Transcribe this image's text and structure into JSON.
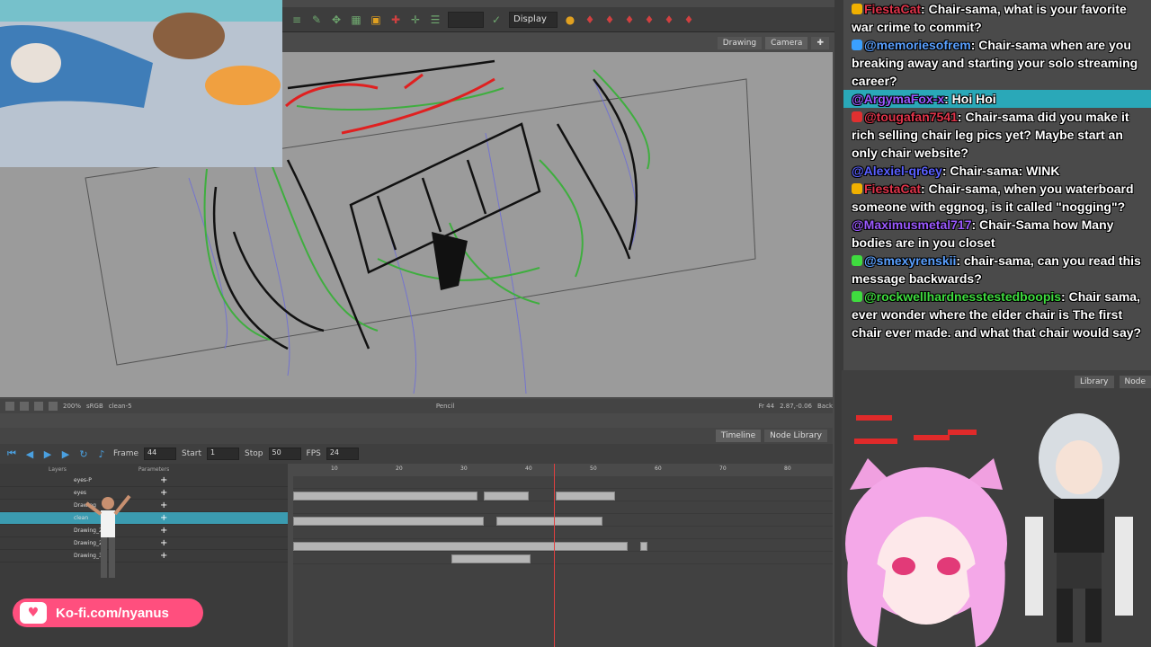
{
  "toolbar": {
    "display_select": "Display"
  },
  "view_tabs": [
    "Drawing",
    "Camera"
  ],
  "canvas_status": {
    "zoom": "200%",
    "color_mode": "sRGB",
    "layer": "clean-5",
    "tool": "Pencil",
    "frame": "Fr 44",
    "coords": "2.87,-0.06",
    "bg": "Back"
  },
  "timeline_tabs": [
    "Timeline",
    "Node Library"
  ],
  "timeline": {
    "frame_label": "Frame",
    "frame_value": "44",
    "start_label": "Start",
    "start_value": "1",
    "stop_label": "Stop",
    "stop_value": "50",
    "fps_label": "FPS",
    "fps_value": "24"
  },
  "layers": {
    "header_layers": "Layers",
    "header_params": "Parameters",
    "rows": [
      "eyes-P",
      "eyes",
      "Drawing",
      "clean",
      "Drawing_2",
      "Drawing_2",
      "Drawing_3"
    ]
  },
  "ruler_ticks": [
    "10",
    "20",
    "30",
    "40",
    "50",
    "60",
    "70",
    "80"
  ],
  "kofi": {
    "text": "Ko-fi.com/nyanus"
  },
  "chat": [
    {
      "user": "FiestaCat",
      "user_color": "#e0344a",
      "text": ": Chair-sama, what is your favorite war crime to commit?"
    },
    {
      "user": "@memoriesofrem",
      "user_color": "#5aa0ff",
      "text": ": Chair-sama when are you breaking away and starting your solo streaming career?"
    },
    {
      "user": "@ArgymaFox-x",
      "user_color": "#9b59ff",
      "text": ": Hoi Hoi",
      "highlight": true
    },
    {
      "user": "@tougafan7541",
      "user_color": "#e0344a",
      "text": ": Chair-sama did you make it rich selling chair leg pics yet? Maybe start an only chair website?"
    },
    {
      "user": "@Alexiel-qr6ey",
      "user_color": "#5a60ff",
      "text": ": Chair-sama: WINK"
    },
    {
      "user": "FiestaCat",
      "user_color": "#e0344a",
      "text": ": Chair-sama, when you waterboard someone with eggnog, is it called \"nogging\"?"
    },
    {
      "user": "@Maximusmetal717",
      "user_color": "#9b59ff",
      "text": ": Chair-Sama how Many bodies are in you closet"
    },
    {
      "user": "@smexyrenskii",
      "user_color": "#5aa0ff",
      "text": ": chair-sama, can you read this message backwards?"
    },
    {
      "user": "@rockwellhardnesstestedboopis",
      "user_color": "#3fdc3f",
      "text": ": Chair sama, ever wonder where the elder chair is The first chair ever made. and what that chair would say?"
    }
  ],
  "node_tabs": [
    "Library",
    "Node"
  ],
  "colors": {
    "kofi": "#ff4f7e",
    "chat_highlight": "#2aa8b8",
    "playhead": "#e04040"
  }
}
